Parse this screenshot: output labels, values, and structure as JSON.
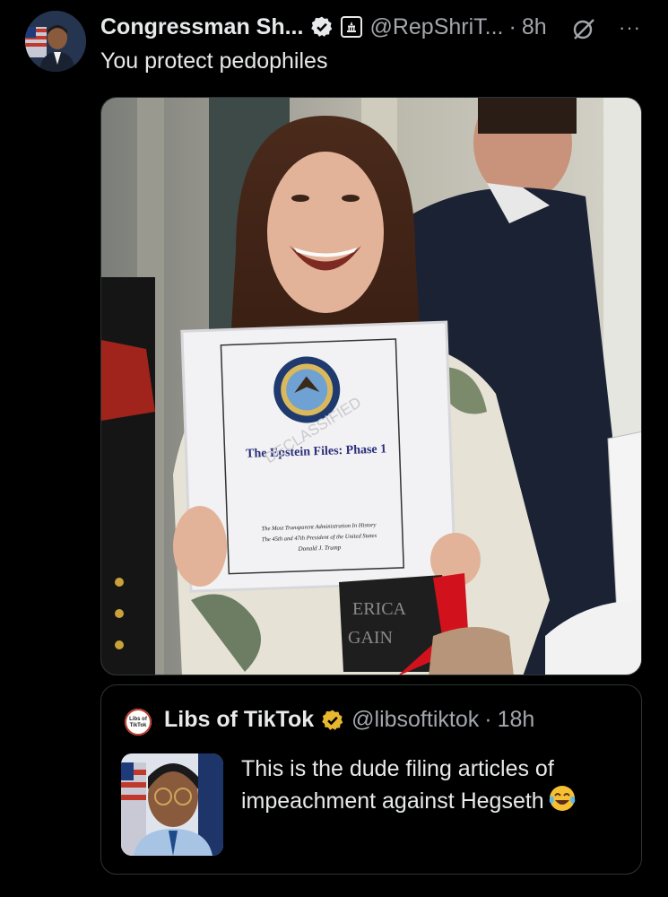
{
  "post": {
    "author_name": "Congressman Sh...",
    "handle": "@RepShriT...",
    "separator": "·",
    "time": "8h",
    "text": "You protect pedophiles",
    "more": "···"
  },
  "media": {
    "binder_title": "The Epstein Files: Phase 1",
    "binder_subtitle_1": "The Most Transparent Administration In History",
    "binder_subtitle_2": "The 45th and 47th President of the United States",
    "binder_subtitle_3": "Donald J. Trump",
    "stamp": "DECLASSIFIED",
    "hat_text_1": "ERICA",
    "hat_text_2": "GAIN"
  },
  "quote": {
    "author_name": "Libs of TikTok",
    "handle": "@libsoftiktok",
    "separator": "·",
    "time": "18h",
    "text": "This is the dude filing articles of impeachment against Hegseth",
    "logo_text_1": "Libs of",
    "logo_text_2": "TikTok"
  },
  "colors": {
    "background": "#000000",
    "secondary_text": "#a3a6aa",
    "verified_gold": "#e8b730",
    "verified_blue": "#1d9bf0"
  }
}
